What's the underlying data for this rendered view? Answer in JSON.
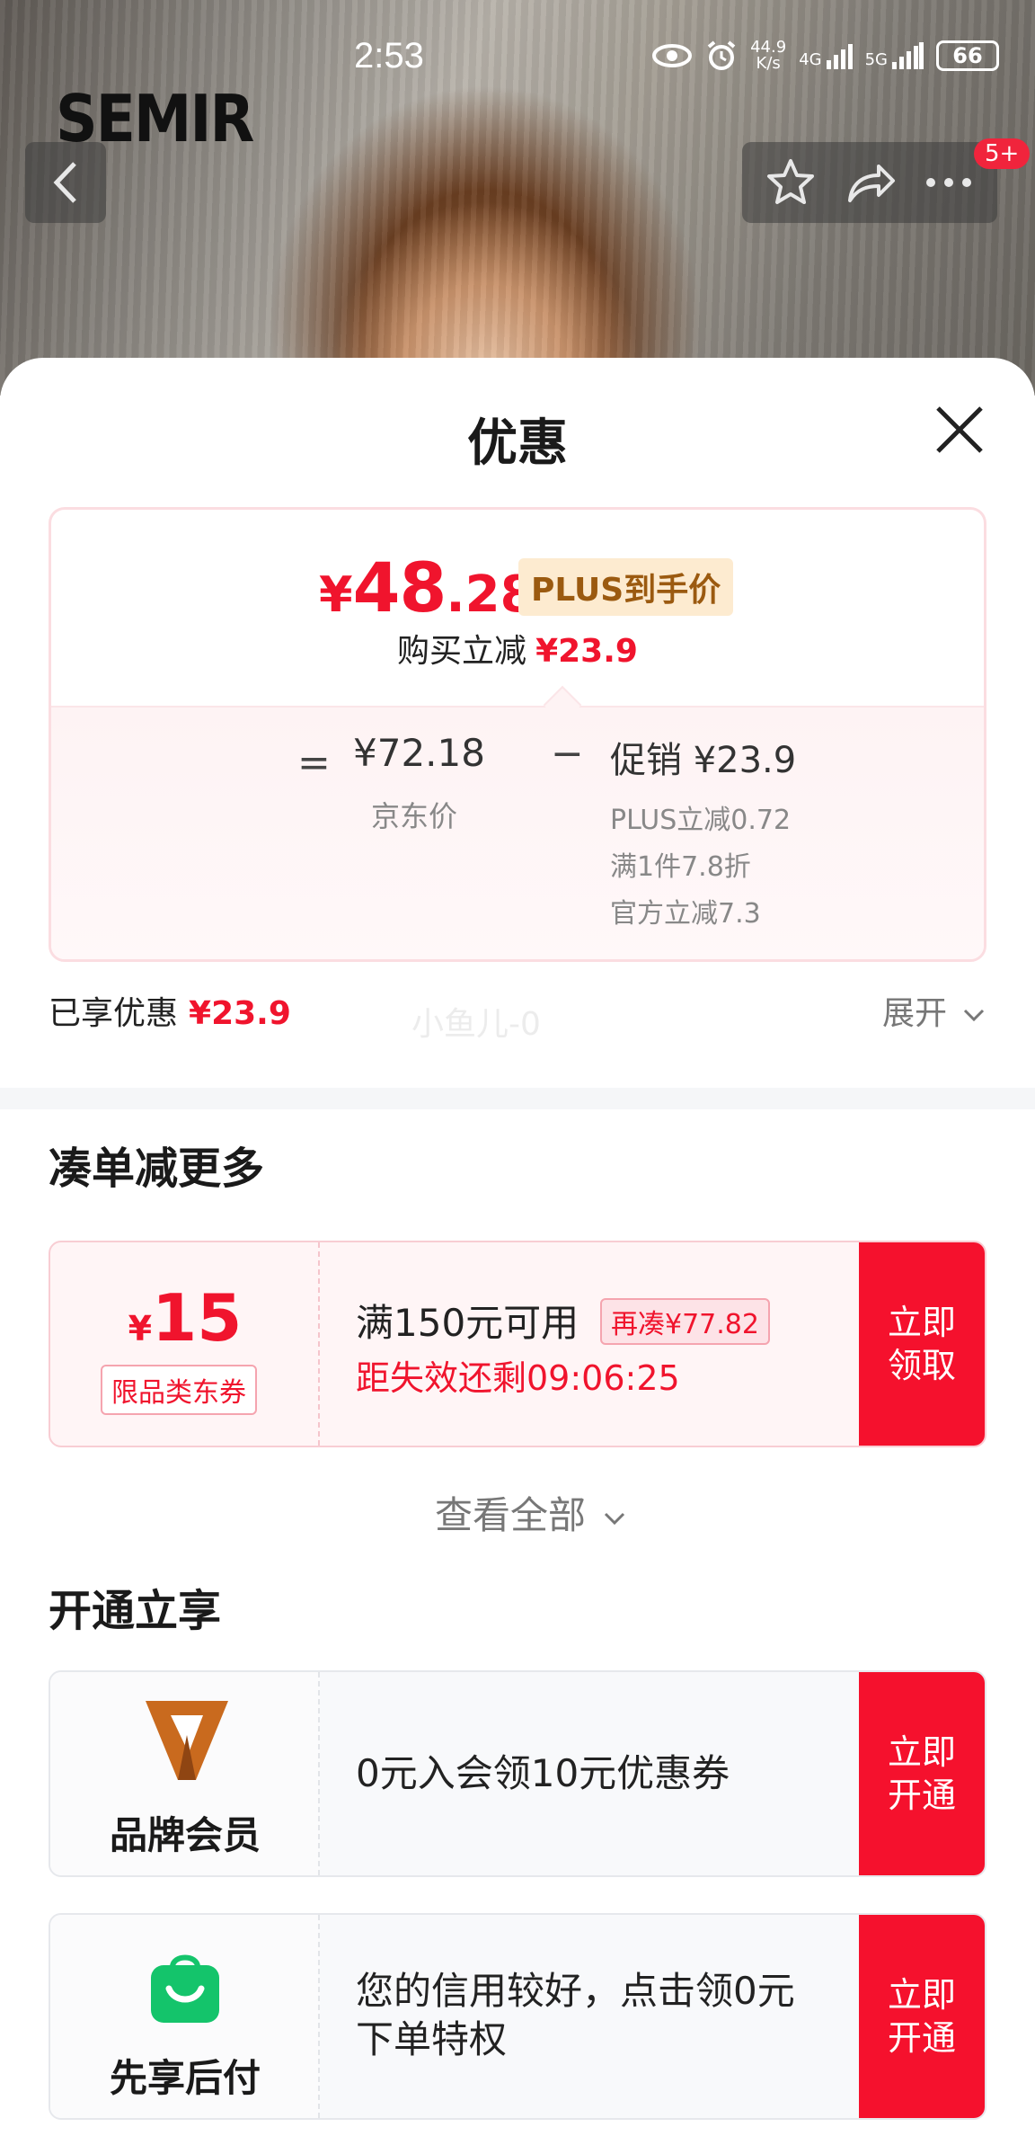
{
  "status_bar": {
    "time": "2:53",
    "net_speed_top": "44.9",
    "net_speed_bottom": "K/s",
    "signal_1": "4G",
    "signal_2": "5G",
    "battery": "66"
  },
  "header": {
    "brand_logo": "SEMIR",
    "badge": "5+"
  },
  "sheet": {
    "title": "优惠",
    "price_card": {
      "currency": "¥",
      "final_int": "48",
      "final_dec": ".28",
      "plus_tag": "PLUS到手价",
      "reduce_label": "购买立减",
      "reduce_amount": "¥23.9",
      "equals": "=",
      "jd_price": "¥72.18",
      "jd_label": "京东价",
      "minus": "−",
      "promo": "促销 ¥23.9",
      "promo_details": [
        "PLUS立减0.72",
        "满1件7.8折",
        "官方立减7.3"
      ]
    },
    "enjoyed_label": "已享优惠",
    "enjoyed_amount": "¥23.9",
    "watermark": "小鱼儿-0",
    "expand_label": "展开"
  },
  "coupon_section": {
    "title": "凑单减更多",
    "coupon": {
      "currency": "¥",
      "amount": "15",
      "type": "限品类东券",
      "condition": "满150元可用",
      "gap": "再凑¥77.82",
      "countdown": "距失效还剩09:06:25",
      "button": "立即\n领取"
    },
    "view_all": "查看全部"
  },
  "benefit_section": {
    "title": "开通立享",
    "items": [
      {
        "name": "品牌会员",
        "text": "0元入会领10元优惠券",
        "button": "立即\n开通",
        "icon": "brand-v-icon",
        "icon_color": "#c96a1e"
      },
      {
        "name": "先享后付",
        "text": "您的信用较好，点击领0元下单特权",
        "button": "立即\n开通",
        "icon": "shopping-bag-icon",
        "icon_color": "#14c46b"
      }
    ]
  },
  "colors": {
    "accent_red": "#f0142d",
    "button_red": "#f5112d",
    "plus_gold": "#9b5a10"
  }
}
